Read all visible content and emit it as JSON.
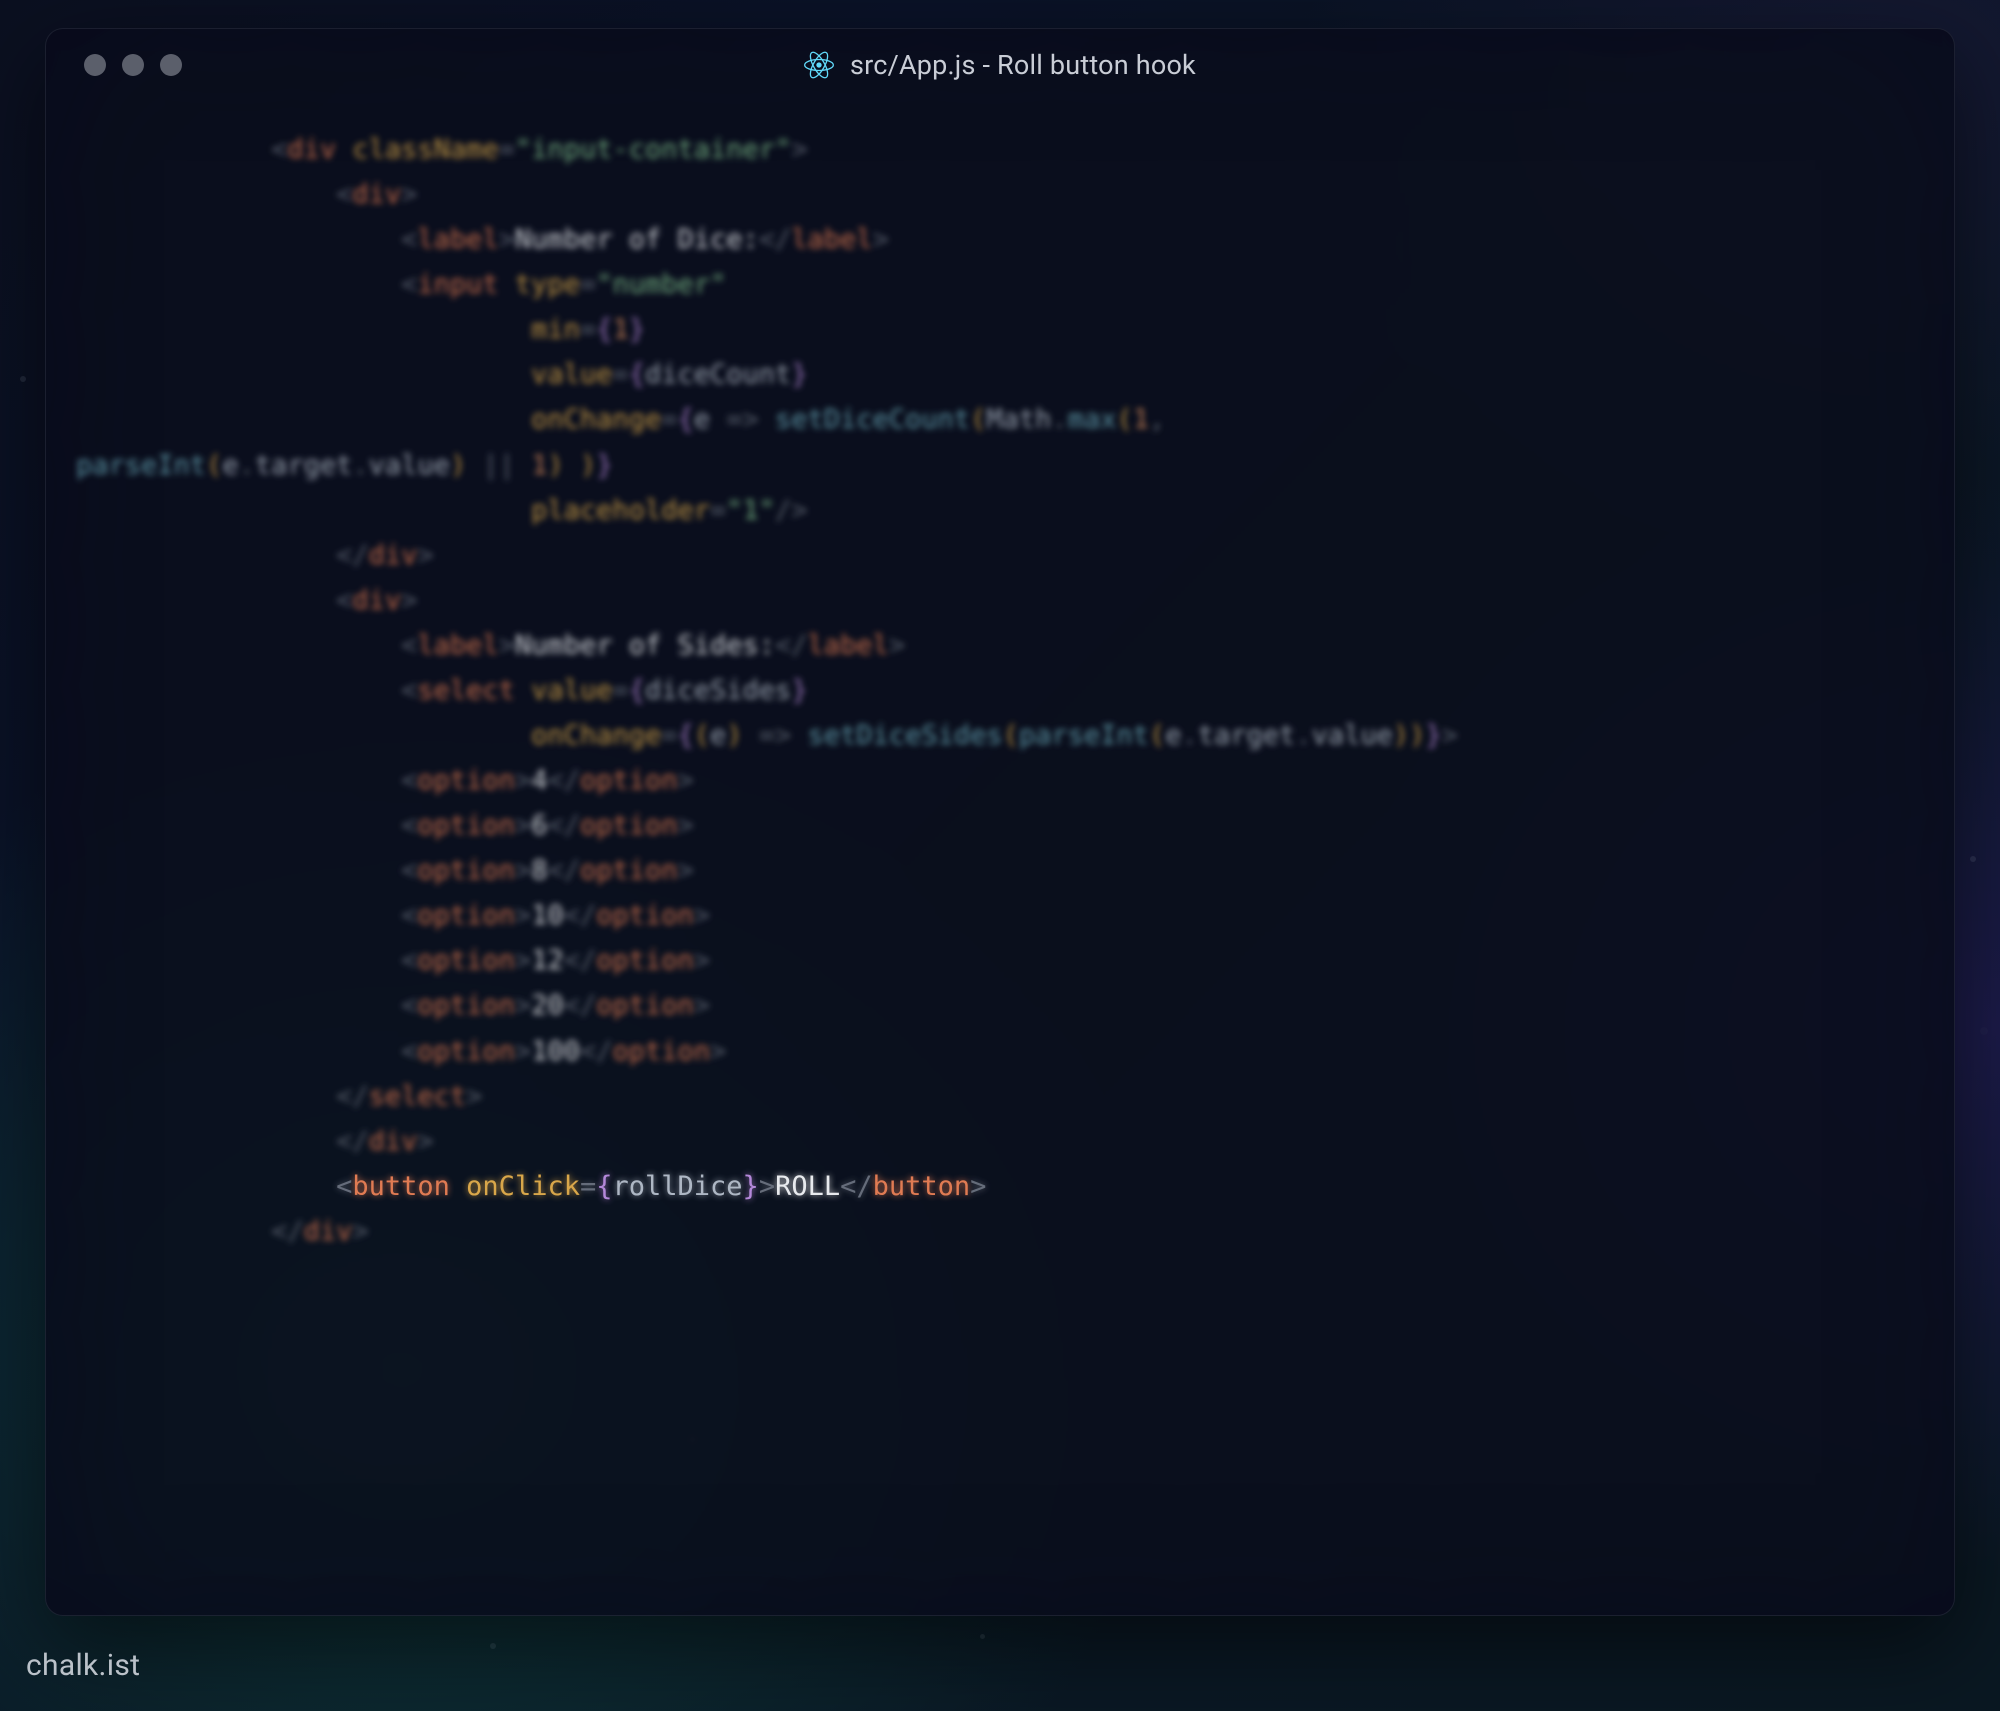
{
  "window": {
    "title": "src/App.js - Roll button hook",
    "icon": "react-icon"
  },
  "watermark": "chalk.ist",
  "code": {
    "lines": [
      {
        "indent": 3,
        "t": [
          [
            "angle",
            "<"
          ],
          [
            "tag",
            "div"
          ],
          [
            "sp",
            " "
          ],
          [
            "attr",
            "className"
          ],
          [
            "eq",
            "="
          ],
          [
            "str",
            "\"input-container\""
          ],
          [
            "angle",
            ">"
          ]
        ]
      },
      {
        "indent": 4,
        "t": [
          [
            "angle",
            "<"
          ],
          [
            "tag",
            "div"
          ],
          [
            "angle",
            ">"
          ]
        ]
      },
      {
        "indent": 5,
        "t": [
          [
            "angle",
            "<"
          ],
          [
            "tag",
            "label"
          ],
          [
            "angle",
            ">"
          ],
          [
            "text",
            "Number of Dice:"
          ],
          [
            "angle",
            "</"
          ],
          [
            "tag",
            "label"
          ],
          [
            "angle",
            ">"
          ]
        ]
      },
      {
        "indent": 5,
        "t": [
          [
            "angle",
            "<"
          ],
          [
            "tag",
            "input"
          ],
          [
            "sp",
            " "
          ],
          [
            "attr",
            "type"
          ],
          [
            "eq",
            "="
          ],
          [
            "str",
            "\"number\""
          ]
        ]
      },
      {
        "indent": 7,
        "t": [
          [
            "attr",
            "min"
          ],
          [
            "eq",
            "="
          ],
          [
            "brace",
            "{"
          ],
          [
            "num",
            "1"
          ],
          [
            "brace",
            "}"
          ]
        ]
      },
      {
        "indent": 7,
        "t": [
          [
            "attr",
            "value"
          ],
          [
            "eq",
            "="
          ],
          [
            "brace",
            "{"
          ],
          [
            "ident",
            "diceCount"
          ],
          [
            "brace",
            "}"
          ]
        ]
      },
      {
        "indent": 7,
        "t": [
          [
            "attr",
            "onChange"
          ],
          [
            "eq",
            "="
          ],
          [
            "brace",
            "{"
          ],
          [
            "ident",
            "e"
          ],
          [
            "sp",
            " "
          ],
          [
            "arrow",
            "=>"
          ],
          [
            "sp",
            " "
          ],
          [
            "func",
            "setDiceCount"
          ],
          [
            "paren",
            "("
          ],
          [
            "ident",
            "Math"
          ],
          [
            "dot",
            "."
          ],
          [
            "func",
            "max"
          ],
          [
            "paren",
            "("
          ],
          [
            "num",
            "1"
          ],
          [
            "punct",
            ","
          ]
        ]
      },
      {
        "indent": 0,
        "t": [
          [
            "func",
            "parseInt"
          ],
          [
            "paren",
            "("
          ],
          [
            "ident",
            "e"
          ],
          [
            "dot",
            "."
          ],
          [
            "ident",
            "target"
          ],
          [
            "dot",
            "."
          ],
          [
            "ident",
            "value"
          ],
          [
            "paren",
            ")"
          ],
          [
            "sp",
            " "
          ],
          [
            "op",
            "||"
          ],
          [
            "sp",
            " "
          ],
          [
            "num",
            "1"
          ],
          [
            "paren",
            ")"
          ],
          [
            "sp",
            " "
          ],
          [
            "paren",
            ")"
          ],
          [
            "brace",
            "}"
          ]
        ]
      },
      {
        "indent": 7,
        "t": [
          [
            "attr",
            "placeholder"
          ],
          [
            "eq",
            "="
          ],
          [
            "str",
            "\"1\""
          ],
          [
            "angle",
            "/>"
          ]
        ]
      },
      {
        "indent": 4,
        "t": [
          [
            "angle",
            "</"
          ],
          [
            "tag",
            "div"
          ],
          [
            "angle",
            ">"
          ]
        ]
      },
      {
        "indent": 4,
        "t": [
          [
            "angle",
            "<"
          ],
          [
            "tag",
            "div"
          ],
          [
            "angle",
            ">"
          ]
        ]
      },
      {
        "indent": 5,
        "t": [
          [
            "angle",
            "<"
          ],
          [
            "tag",
            "label"
          ],
          [
            "angle",
            ">"
          ],
          [
            "text",
            "Number of Sides:"
          ],
          [
            "angle",
            "</"
          ],
          [
            "tag",
            "label"
          ],
          [
            "angle",
            ">"
          ]
        ]
      },
      {
        "indent": 5,
        "t": [
          [
            "angle",
            "<"
          ],
          [
            "tag",
            "select"
          ],
          [
            "sp",
            " "
          ],
          [
            "attr",
            "value"
          ],
          [
            "eq",
            "="
          ],
          [
            "brace",
            "{"
          ],
          [
            "ident",
            "diceSides"
          ],
          [
            "brace",
            "}"
          ]
        ]
      },
      {
        "indent": 7,
        "t": [
          [
            "attr",
            "onChange"
          ],
          [
            "eq",
            "="
          ],
          [
            "brace",
            "{"
          ],
          [
            "paren",
            "("
          ],
          [
            "ident",
            "e"
          ],
          [
            "paren",
            ")"
          ],
          [
            "sp",
            " "
          ],
          [
            "arrow",
            "=>"
          ],
          [
            "sp",
            " "
          ],
          [
            "func",
            "setDiceSides"
          ],
          [
            "paren",
            "("
          ],
          [
            "func",
            "parseInt"
          ],
          [
            "paren",
            "("
          ],
          [
            "ident",
            "e"
          ],
          [
            "dot",
            "."
          ],
          [
            "ident",
            "target"
          ],
          [
            "dot",
            "."
          ],
          [
            "ident",
            "value"
          ],
          [
            "paren",
            ")"
          ],
          [
            "paren",
            ")"
          ],
          [
            "brace",
            "}"
          ],
          [
            "angle",
            ">"
          ]
        ]
      },
      {
        "indent": 5,
        "t": [
          [
            "angle",
            "<"
          ],
          [
            "tag",
            "option"
          ],
          [
            "angle",
            ">"
          ],
          [
            "text",
            "4"
          ],
          [
            "angle",
            "</"
          ],
          [
            "tag",
            "option"
          ],
          [
            "angle",
            ">"
          ]
        ]
      },
      {
        "indent": 5,
        "t": [
          [
            "angle",
            "<"
          ],
          [
            "tag",
            "option"
          ],
          [
            "angle",
            ">"
          ],
          [
            "text",
            "6"
          ],
          [
            "angle",
            "</"
          ],
          [
            "tag",
            "option"
          ],
          [
            "angle",
            ">"
          ]
        ]
      },
      {
        "indent": 5,
        "t": [
          [
            "angle",
            "<"
          ],
          [
            "tag",
            "option"
          ],
          [
            "angle",
            ">"
          ],
          [
            "text",
            "8"
          ],
          [
            "angle",
            "</"
          ],
          [
            "tag",
            "option"
          ],
          [
            "angle",
            ">"
          ]
        ]
      },
      {
        "indent": 5,
        "t": [
          [
            "angle",
            "<"
          ],
          [
            "tag",
            "option"
          ],
          [
            "angle",
            ">"
          ],
          [
            "text",
            "10"
          ],
          [
            "angle",
            "</"
          ],
          [
            "tag",
            "option"
          ],
          [
            "angle",
            ">"
          ]
        ]
      },
      {
        "indent": 5,
        "t": [
          [
            "angle",
            "<"
          ],
          [
            "tag",
            "option"
          ],
          [
            "angle",
            ">"
          ],
          [
            "text",
            "12"
          ],
          [
            "angle",
            "</"
          ],
          [
            "tag",
            "option"
          ],
          [
            "angle",
            ">"
          ]
        ]
      },
      {
        "indent": 5,
        "t": [
          [
            "angle",
            "<"
          ],
          [
            "tag",
            "option"
          ],
          [
            "angle",
            ">"
          ],
          [
            "text",
            "20"
          ],
          [
            "angle",
            "</"
          ],
          [
            "tag",
            "option"
          ],
          [
            "angle",
            ">"
          ]
        ]
      },
      {
        "indent": 5,
        "t": [
          [
            "angle",
            "<"
          ],
          [
            "tag",
            "option"
          ],
          [
            "angle",
            ">"
          ],
          [
            "text",
            "100"
          ],
          [
            "angle",
            "</"
          ],
          [
            "tag",
            "option"
          ],
          [
            "angle",
            ">"
          ]
        ]
      },
      {
        "indent": 4,
        "t": [
          [
            "angle",
            "</"
          ],
          [
            "tag",
            "select"
          ],
          [
            "angle",
            ">"
          ]
        ]
      },
      {
        "indent": 4,
        "t": [
          [
            "angle",
            "</"
          ],
          [
            "tag",
            "div"
          ],
          [
            "angle",
            ">"
          ]
        ]
      },
      {
        "indent": 4,
        "focus": true,
        "t": [
          [
            "angle",
            "<"
          ],
          [
            "tag",
            "button"
          ],
          [
            "sp",
            " "
          ],
          [
            "attr",
            "onClick"
          ],
          [
            "eq",
            "="
          ],
          [
            "brace",
            "{"
          ],
          [
            "ident",
            "rollDice"
          ],
          [
            "brace",
            "}"
          ],
          [
            "angle",
            ">"
          ],
          [
            "text",
            "ROLL"
          ],
          [
            "angle",
            "</"
          ],
          [
            "tag",
            "button"
          ],
          [
            "angle",
            ">"
          ]
        ]
      },
      {
        "indent": 3,
        "t": [
          [
            "angle",
            "</"
          ],
          [
            "tag",
            "div"
          ],
          [
            "angle",
            ">"
          ]
        ]
      }
    ]
  }
}
